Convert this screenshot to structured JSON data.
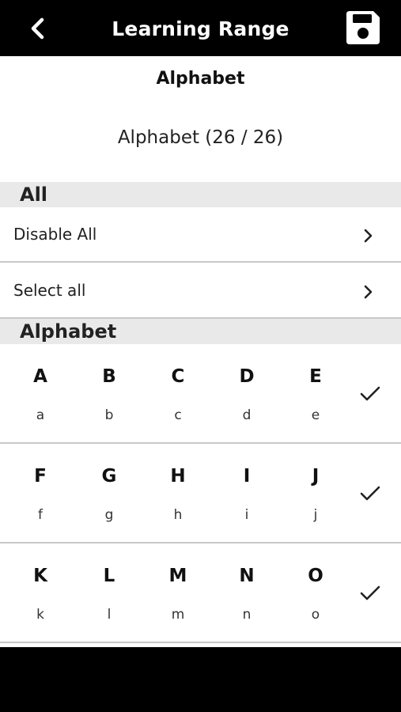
{
  "header": {
    "title": "Learning Range",
    "back_icon": "chevron-left-icon",
    "save_icon": "floppy-disk-icon"
  },
  "subtitle": "Alphabet",
  "summary": "Alphabet (26 / 26)",
  "sections": {
    "all": {
      "title": "All",
      "items": [
        {
          "label": "Disable All",
          "icon": "chevron-right-icon"
        },
        {
          "label": "Select all",
          "icon": "chevron-right-icon"
        }
      ]
    },
    "alphabet": {
      "title": "Alphabet",
      "rows": [
        {
          "letters": [
            {
              "upper": "A",
              "lower": "a"
            },
            {
              "upper": "B",
              "lower": "b"
            },
            {
              "upper": "C",
              "lower": "c"
            },
            {
              "upper": "D",
              "lower": "d"
            },
            {
              "upper": "E",
              "lower": "e"
            }
          ],
          "checked": true
        },
        {
          "letters": [
            {
              "upper": "F",
              "lower": "f"
            },
            {
              "upper": "G",
              "lower": "g"
            },
            {
              "upper": "H",
              "lower": "h"
            },
            {
              "upper": "I",
              "lower": "i"
            },
            {
              "upper": "J",
              "lower": "j"
            }
          ],
          "checked": true
        },
        {
          "letters": [
            {
              "upper": "K",
              "lower": "k"
            },
            {
              "upper": "L",
              "lower": "l"
            },
            {
              "upper": "M",
              "lower": "m"
            },
            {
              "upper": "N",
              "lower": "n"
            },
            {
              "upper": "O",
              "lower": "o"
            }
          ],
          "checked": true
        }
      ]
    }
  },
  "colors": {
    "topbar": "#000000",
    "section_bg": "#e9e9e9",
    "divider": "#c8c8c8"
  }
}
